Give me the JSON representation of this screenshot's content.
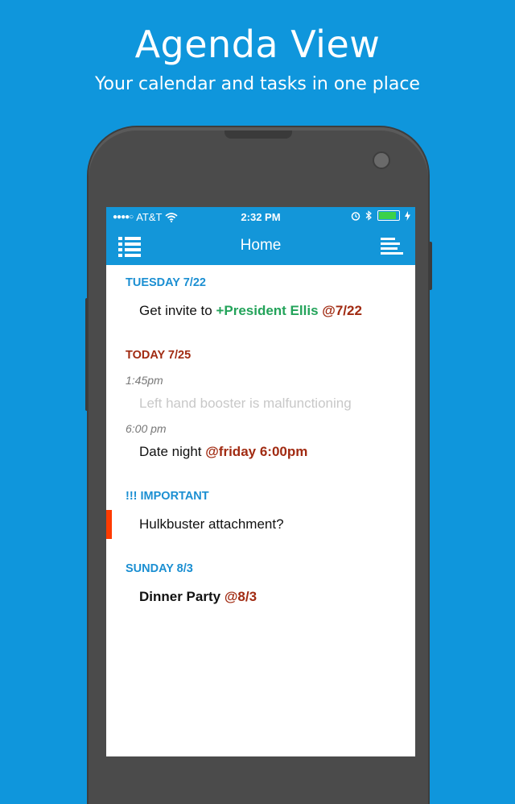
{
  "promo": {
    "title": "Agenda View",
    "subtitle": "Your calendar and tasks in one place"
  },
  "statusbar": {
    "carrier": "AT&T",
    "signal_dots": "●●●●○",
    "time": "2:32 PM",
    "icons": [
      "wifi-icon",
      "alarm-icon",
      "bluetooth-icon",
      "battery-icon",
      "charging-icon"
    ],
    "battery_color": "#3bd14a"
  },
  "navbar": {
    "title": "Home",
    "left_icon": "list-menu-icon",
    "right_icon": "sort-lines-icon"
  },
  "sections": [
    {
      "header": "TUESDAY 7/22",
      "items": [
        {
          "text": "Get invite to ",
          "tag1": "+President Ellis",
          "tag2": " @7/22"
        }
      ]
    },
    {
      "header": "TODAY 7/25",
      "items": [
        {
          "time": "1:45pm",
          "text": "Left hand booster is malfunctioning"
        },
        {
          "time": "6:00 pm",
          "text": "Date night ",
          "tag": "@friday 6:00pm"
        }
      ]
    },
    {
      "header": "!!!  IMPORTANT",
      "items": [
        {
          "text": "Hulkbuster attachment?"
        }
      ]
    },
    {
      "header": "SUNDAY 8/3",
      "items": [
        {
          "text": "Dinner Party ",
          "tag": "@8/3"
        }
      ]
    }
  ],
  "colors": {
    "background": "#0f96dc",
    "bar": "#1396d9",
    "header_blue": "#1b8fd2",
    "today_red": "#a12b12",
    "tag_green": "#23a35a",
    "priority": "#ff3b00"
  }
}
